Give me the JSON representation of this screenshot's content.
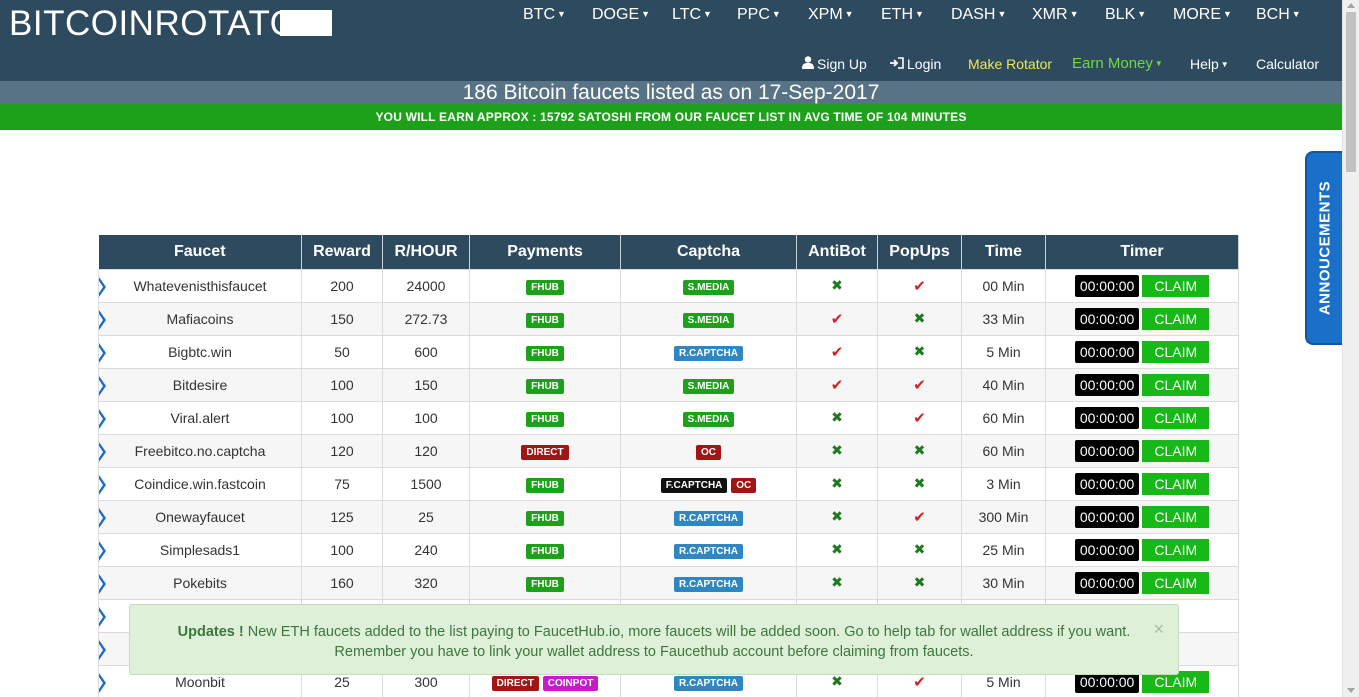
{
  "header": {
    "logo": "BITCOINROTATOR",
    "coins": [
      {
        "label": "BTC"
      },
      {
        "label": "DOGE"
      },
      {
        "label": "LTC"
      },
      {
        "label": "PPC"
      },
      {
        "label": "XPM"
      },
      {
        "label": "ETH"
      },
      {
        "label": "DASH"
      },
      {
        "label": "XMR"
      },
      {
        "label": "BLK"
      },
      {
        "label": "MORE"
      },
      {
        "label": "BCH"
      }
    ],
    "nav": {
      "signup": "Sign Up",
      "login": "Login",
      "make_rotator": "Make Rotator",
      "earn_money": "Earn Money",
      "help": "Help",
      "calculator": "Calculator"
    },
    "colors": {
      "header_bg": "#2e4a5f",
      "make_rotator": "#f2e94c",
      "earn_money": "#6fdc3c"
    }
  },
  "title_bar": {
    "text": "186 Bitcoin faucets listed as on 17-Sep-2017"
  },
  "earn_bar": {
    "text": "YOU WILL EARN APPROX : 15792 SATOSHI FROM OUR FAUCET LIST IN AVG TIME OF 104 MINUTES"
  },
  "announcements_tab": {
    "label": "ANNOUCEMENTS"
  },
  "table": {
    "headers": [
      "Faucet",
      "Reward",
      "R/HOUR",
      "Payments",
      "Captcha",
      "AntiBot",
      "PopUps",
      "Time",
      "Timer"
    ],
    "claim_label": "CLAIM",
    "rows": [
      {
        "faucet": "Whatevenisthisfaucet",
        "reward": "200",
        "rhour": "24000",
        "payments": [
          "FHUB"
        ],
        "captcha": [
          "S.MEDIA"
        ],
        "antibot": "cross",
        "popups": "check",
        "time": "00 Min",
        "timer": "00:00:00"
      },
      {
        "faucet": "Mafiacoins",
        "reward": "150",
        "rhour": "272.73",
        "payments": [
          "FHUB"
        ],
        "captcha": [
          "S.MEDIA"
        ],
        "antibot": "check",
        "popups": "cross",
        "time": "33 Min",
        "timer": "00:00:00"
      },
      {
        "faucet": "Bigbtc.win",
        "reward": "50",
        "rhour": "600",
        "payments": [
          "FHUB"
        ],
        "captcha": [
          "R.CAPTCHA"
        ],
        "antibot": "check",
        "popups": "cross",
        "time": "5 Min",
        "timer": "00:00:00"
      },
      {
        "faucet": "Bitdesire",
        "reward": "100",
        "rhour": "150",
        "payments": [
          "FHUB"
        ],
        "captcha": [
          "S.MEDIA"
        ],
        "antibot": "check",
        "popups": "check",
        "time": "40 Min",
        "timer": "00:00:00"
      },
      {
        "faucet": "Viral.alert",
        "reward": "100",
        "rhour": "100",
        "payments": [
          "FHUB"
        ],
        "captcha": [
          "S.MEDIA"
        ],
        "antibot": "cross",
        "popups": "check",
        "time": "60 Min",
        "timer": "00:00:00"
      },
      {
        "faucet": "Freebitco.no.captcha",
        "reward": "120",
        "rhour": "120",
        "payments": [
          "DIRECT"
        ],
        "captcha": [
          "OC"
        ],
        "antibot": "cross",
        "popups": "cross",
        "time": "60 Min",
        "timer": "00:00:00"
      },
      {
        "faucet": "Coindice.win.fastcoin",
        "reward": "75",
        "rhour": "1500",
        "payments": [
          "FHUB"
        ],
        "captcha": [
          "F.CAPTCHA",
          "OC"
        ],
        "antibot": "cross",
        "popups": "cross",
        "time": "3 Min",
        "timer": "00:00:00"
      },
      {
        "faucet": "Onewayfaucet",
        "reward": "125",
        "rhour": "25",
        "payments": [
          "FHUB"
        ],
        "captcha": [
          "R.CAPTCHA"
        ],
        "antibot": "cross",
        "popups": "check",
        "time": "300 Min",
        "timer": "00:00:00"
      },
      {
        "faucet": "Simplesads1",
        "reward": "100",
        "rhour": "240",
        "payments": [
          "FHUB"
        ],
        "captcha": [
          "R.CAPTCHA"
        ],
        "antibot": "cross",
        "popups": "cross",
        "time": "25 Min",
        "timer": "00:00:00"
      },
      {
        "faucet": "Pokebits",
        "reward": "160",
        "rhour": "320",
        "payments": [
          "FHUB"
        ],
        "captcha": [
          "R.CAPTCHA"
        ],
        "antibot": "cross",
        "popups": "cross",
        "time": "30 Min",
        "timer": "00:00:00"
      },
      {
        "faucet": "",
        "reward": "",
        "rhour": "",
        "payments": [],
        "captcha": [],
        "antibot": "",
        "popups": "",
        "time": "",
        "timer": ""
      },
      {
        "faucet": "",
        "reward": "",
        "rhour": "",
        "payments": [],
        "captcha": [],
        "antibot": "",
        "popups": "",
        "time": "",
        "timer": ""
      },
      {
        "faucet": "Moonbit",
        "reward": "25",
        "rhour": "300",
        "payments": [
          "DIRECT",
          "COINPOT"
        ],
        "captcha": [
          "R.CAPTCHA"
        ],
        "antibot": "cross",
        "popups": "check",
        "time": "5 Min",
        "timer": "00:00:00"
      }
    ]
  },
  "alert": {
    "bold": "Updates !",
    "line1": "New ETH faucets added to the list paying to FaucetHub.io, more faucets will be added soon. Go to help tab for wallet address if you want.",
    "line2": "Remember you have to link your wallet address to Faucethub account before claiming from faucets.",
    "close": "×"
  }
}
